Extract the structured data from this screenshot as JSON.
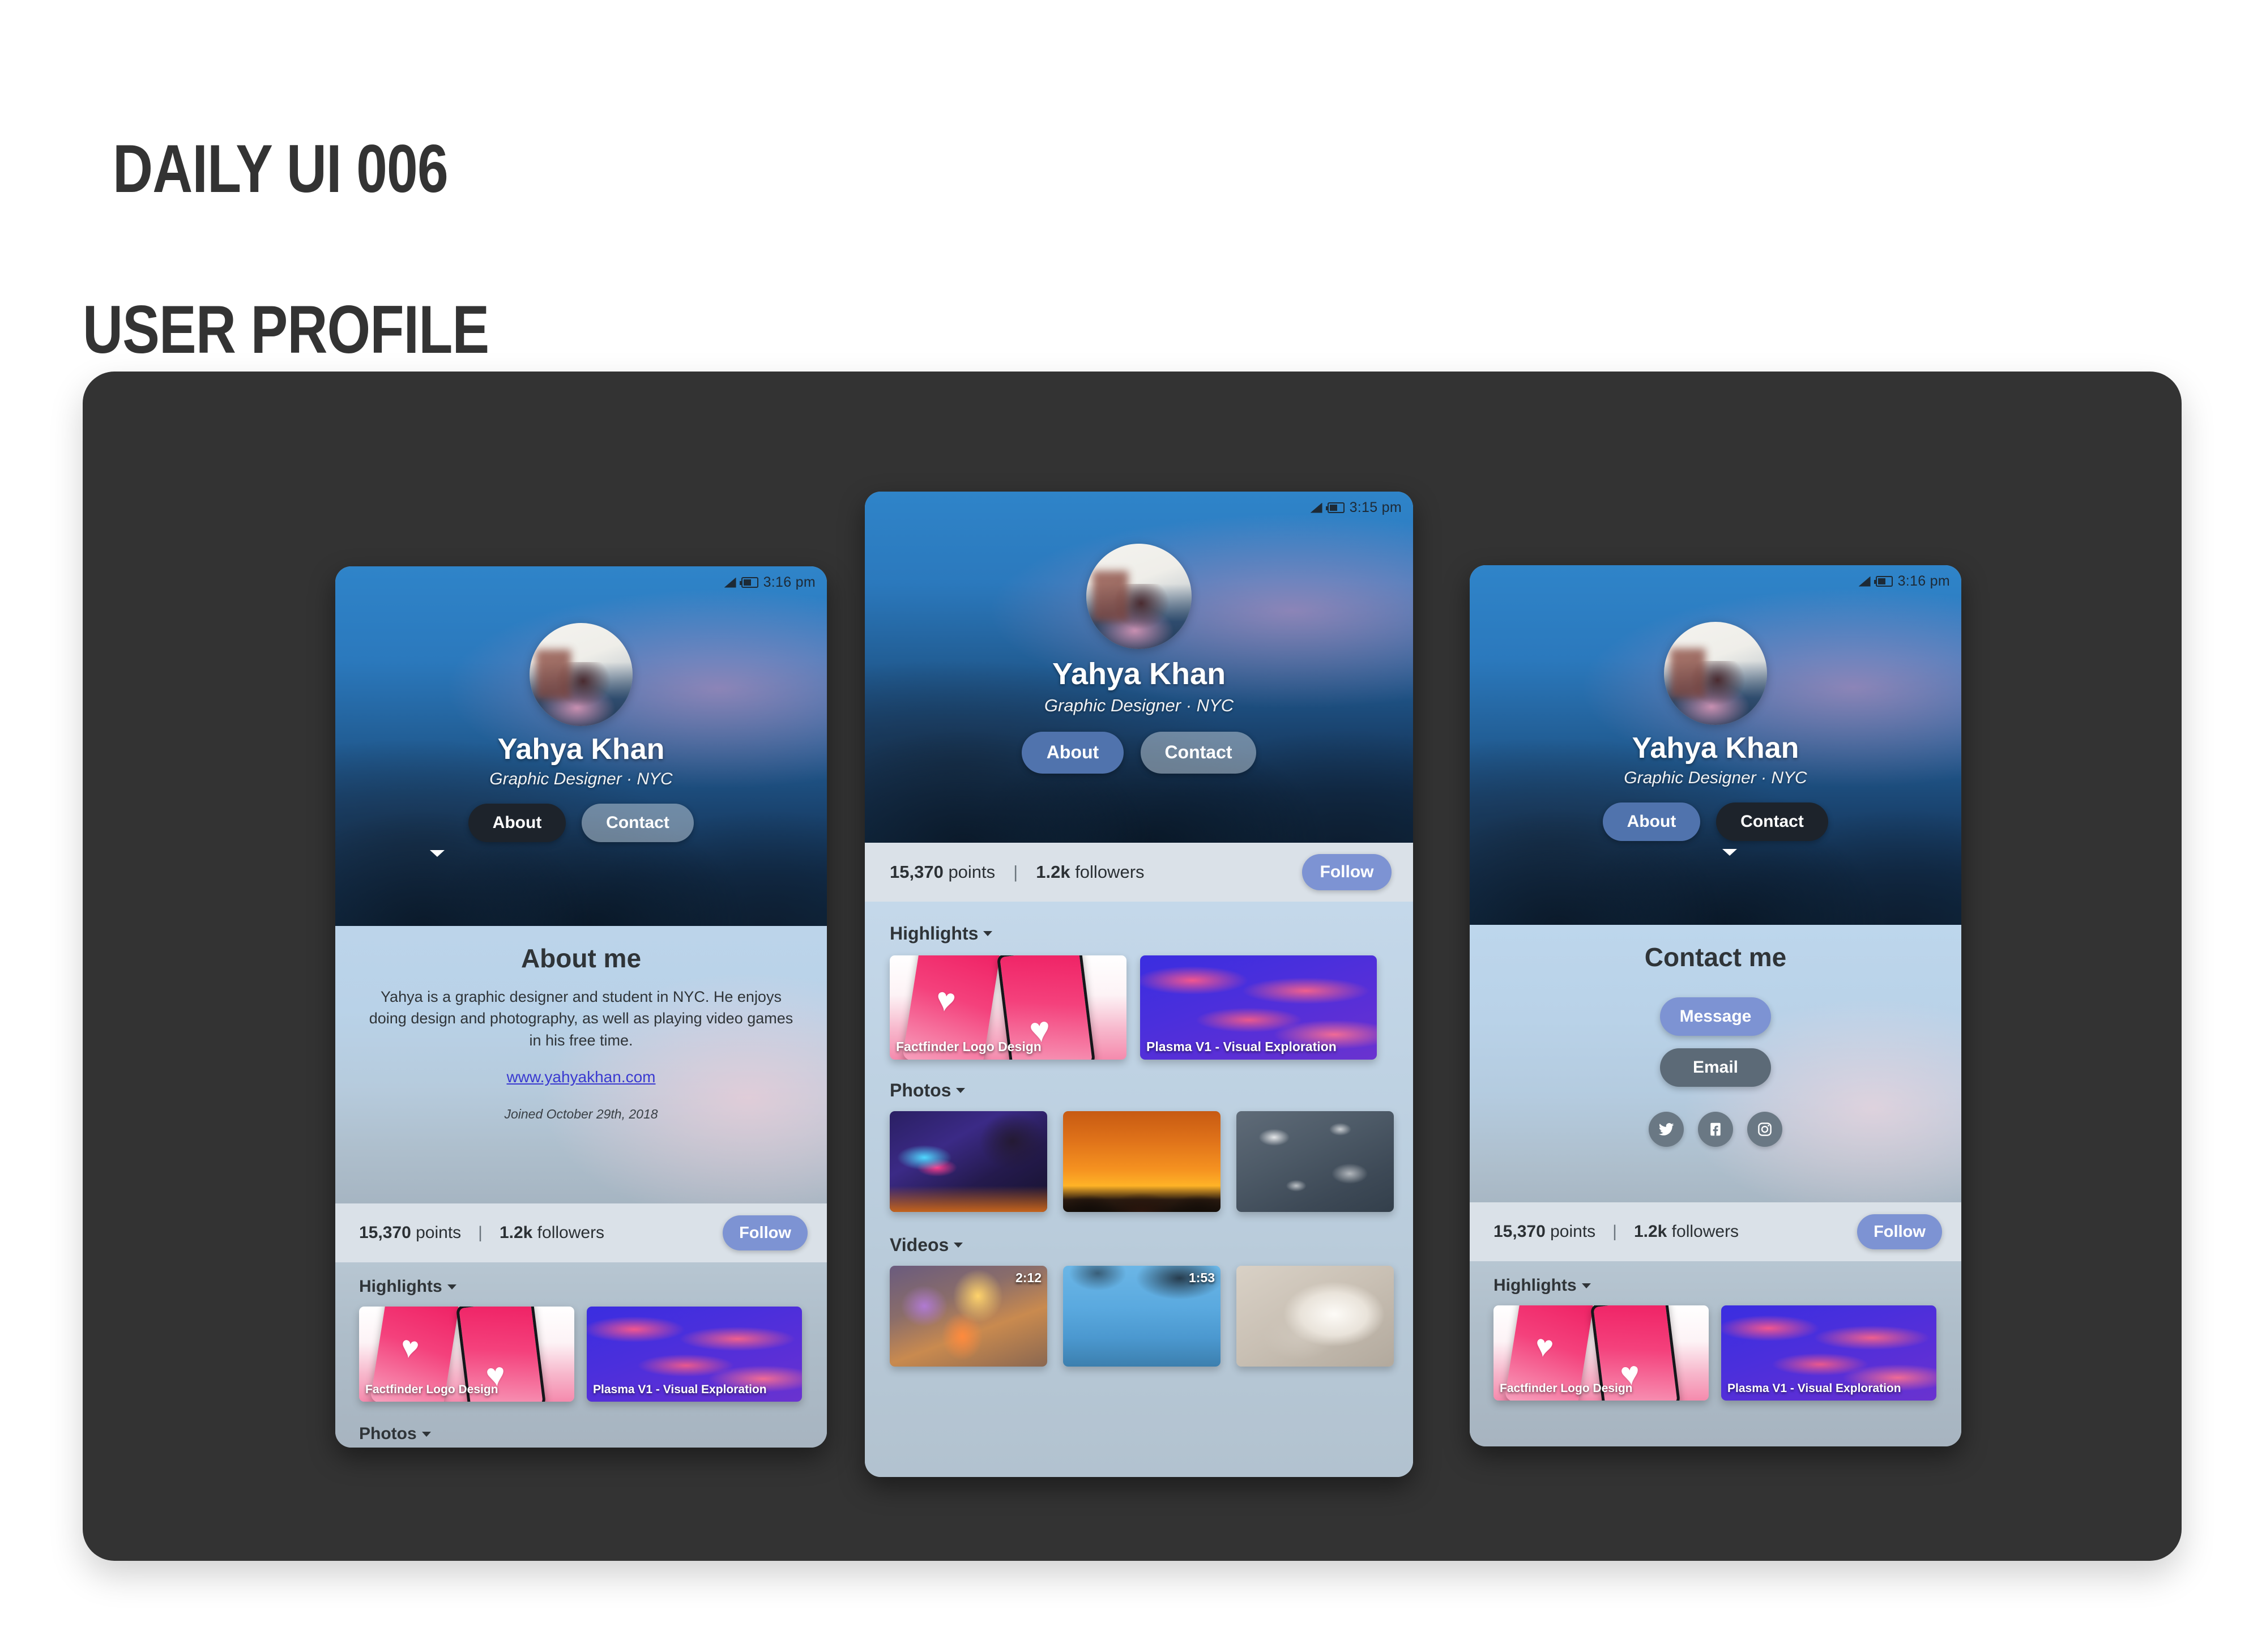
{
  "title": {
    "line1": "DAILY UI 006",
    "line2": "USER PROFILE"
  },
  "profile": {
    "name": "Yahya Khan",
    "role": "Graphic Designer · NYC",
    "tab_about": "About",
    "tab_contact": "Contact"
  },
  "status": {
    "time_left": "3:16 pm",
    "time_center": "3:15 pm",
    "time_right": "3:16 pm",
    "signal_icon": "signal-bars-icon",
    "battery_icon": "battery-icon"
  },
  "about": {
    "heading": "About me",
    "bio": "Yahya is a graphic designer and student in NYC. He enjoys doing design and photography, as well as playing video games in his free time.",
    "website": "www.yahyakhan.com",
    "joined": "Joined October 29th, 2018"
  },
  "contact": {
    "heading": "Contact me",
    "message_label": "Message",
    "email_label": "Email",
    "socials": [
      {
        "name": "twitter-icon",
        "label": "Twitter"
      },
      {
        "name": "facebook-icon",
        "label": "Facebook"
      },
      {
        "name": "instagram-icon",
        "label": "Instagram"
      }
    ]
  },
  "stats": {
    "points_value": "15,370",
    "points_label": " points",
    "separator": "|",
    "followers_value": "1.2k",
    "followers_label": " followers",
    "follow_label": "Follow"
  },
  "sections": {
    "highlights": "Highlights",
    "photos": "Photos",
    "videos": "Videos"
  },
  "highlights": [
    {
      "title": "Factfinder Logo Design",
      "art": "factfinder"
    },
    {
      "title": "Plasma V1 - Visual Exploration",
      "art": "plasma"
    }
  ],
  "photos": [
    {
      "art": "neon"
    },
    {
      "art": "sunset"
    },
    {
      "art": "snow"
    }
  ],
  "videos": [
    {
      "art": "lights",
      "duration": "2:12"
    },
    {
      "art": "tree",
      "duration": "1:53"
    },
    {
      "art": "bulb",
      "duration": ""
    }
  ],
  "colors": {
    "stage": "#333333",
    "accent_blue": "#7d93d3",
    "tab_active_dark": "#1d232b",
    "tab_blue": "#5073ad",
    "link": "#3a3ad0",
    "title_text": "#333333"
  }
}
